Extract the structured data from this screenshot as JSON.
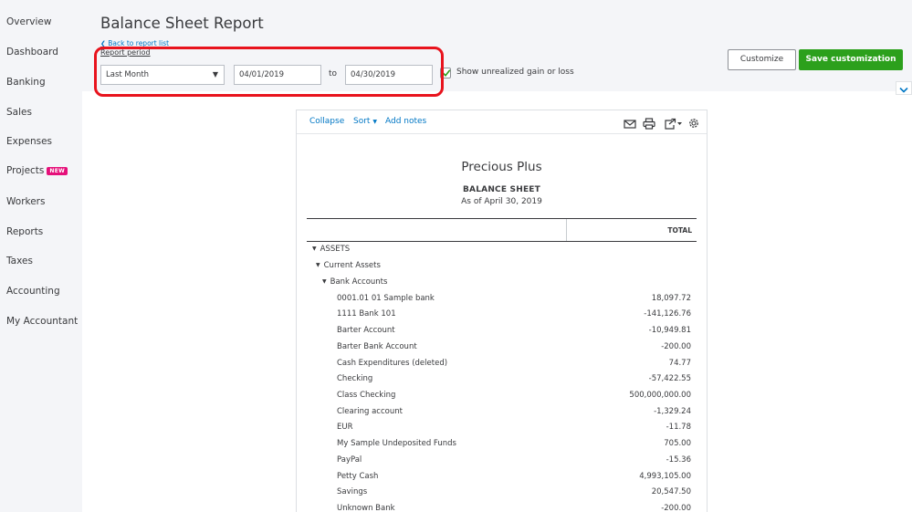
{
  "sidebar": {
    "items": [
      {
        "label": "Overview"
      },
      {
        "label": "Dashboard"
      },
      {
        "label": "Banking"
      },
      {
        "label": "Sales"
      },
      {
        "label": "Expenses"
      },
      {
        "label": "Projects",
        "badge": "NEW"
      },
      {
        "label": "Workers"
      },
      {
        "label": "Reports"
      },
      {
        "label": "Taxes"
      },
      {
        "label": "Accounting"
      },
      {
        "label": "My Accountant"
      }
    ]
  },
  "header": {
    "title": "Balance Sheet Report",
    "back_link": "Back to report list",
    "period_label": "Report period",
    "period_value": "Last Month",
    "from_date": "04/01/2019",
    "to_label": "to",
    "to_date": "04/30/2019",
    "unrealized_label": "Show unrealized gain or loss",
    "unrealized_checked": true,
    "customize_label": "Customize",
    "save_label": "Save customization"
  },
  "colors": {
    "accent_green": "#2ca01c",
    "link_blue": "#0077c5",
    "highlight_red": "#e8131d",
    "badge_pink": "#e5107a"
  },
  "toolbar": {
    "collapse": "Collapse",
    "sort": "Sort",
    "add_notes": "Add notes",
    "icons": [
      "email-icon",
      "print-icon",
      "export-icon",
      "settings-icon"
    ]
  },
  "report": {
    "company": "Precious Plus",
    "title": "BALANCE SHEET",
    "as_of": "As of April 30, 2019",
    "column_header": "TOTAL",
    "sections": {
      "assets": "ASSETS",
      "current_assets": "Current Assets",
      "bank_accounts": "Bank Accounts"
    },
    "rows": [
      {
        "label": "0001.01 01 Sample bank",
        "amount": "18,097.72"
      },
      {
        "label": "1111 Bank 101",
        "amount": "-141,126.76"
      },
      {
        "label": "Barter Account",
        "amount": "-10,949.81"
      },
      {
        "label": "Barter Bank Account",
        "amount": "-200.00"
      },
      {
        "label": "Cash Expenditures (deleted)",
        "amount": "74.77"
      },
      {
        "label": "Checking",
        "amount": "-57,422.55"
      },
      {
        "label": "Class Checking",
        "amount": "500,000,000.00"
      },
      {
        "label": "Clearing account",
        "amount": "-1,329.24"
      },
      {
        "label": "EUR",
        "amount": "-11.78"
      },
      {
        "label": "My Sample Undeposited Funds",
        "amount": "705.00"
      },
      {
        "label": "PayPal",
        "amount": "-15.36"
      },
      {
        "label": "Petty Cash",
        "amount": "4,993,105.00"
      },
      {
        "label": "Savings",
        "amount": "20,547.50"
      },
      {
        "label": "Unknown Bank",
        "amount": "-200.00"
      }
    ]
  }
}
